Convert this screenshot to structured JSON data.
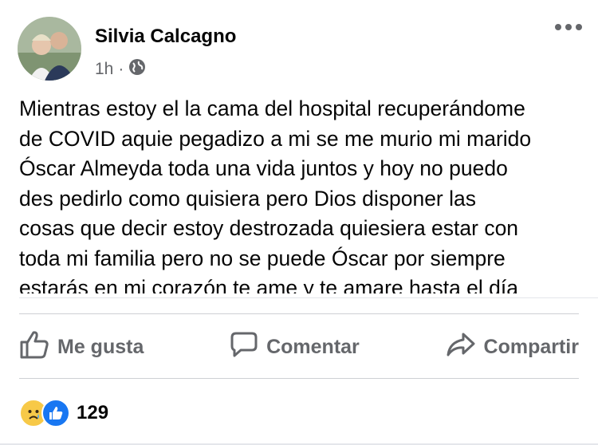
{
  "post": {
    "author": "Silvia Calcagno",
    "time": "1h",
    "separator": "·",
    "privacy_icon": "globe-icon",
    "body_lines": [
      "Mientras estoy el la cama del hospital recuperándome",
      "de COVID aquie pegadizo a mi se me murio mi marido",
      "Óscar Almeyda toda una vida juntos y hoy no puedo",
      "des pedirlo  como quisiera pero Dios disponer las",
      "cosas que decir estoy destrozada  quiesiera estar con",
      "toda mi familia pero no se puede Óscar por siempre",
      "estarás en mi corazón  te ame y te amare hasta el día"
    ]
  },
  "actions": {
    "like_label": "Me gusta",
    "comment_label": "Comentar",
    "share_label": "Compartir"
  },
  "reactions": {
    "icons": [
      "sad-icon",
      "like-icon"
    ],
    "count": "129"
  },
  "colors": {
    "text": "#050505",
    "secondary": "#65676b",
    "like_blue": "#1877f2",
    "sad_yellow": "#f7c948"
  }
}
